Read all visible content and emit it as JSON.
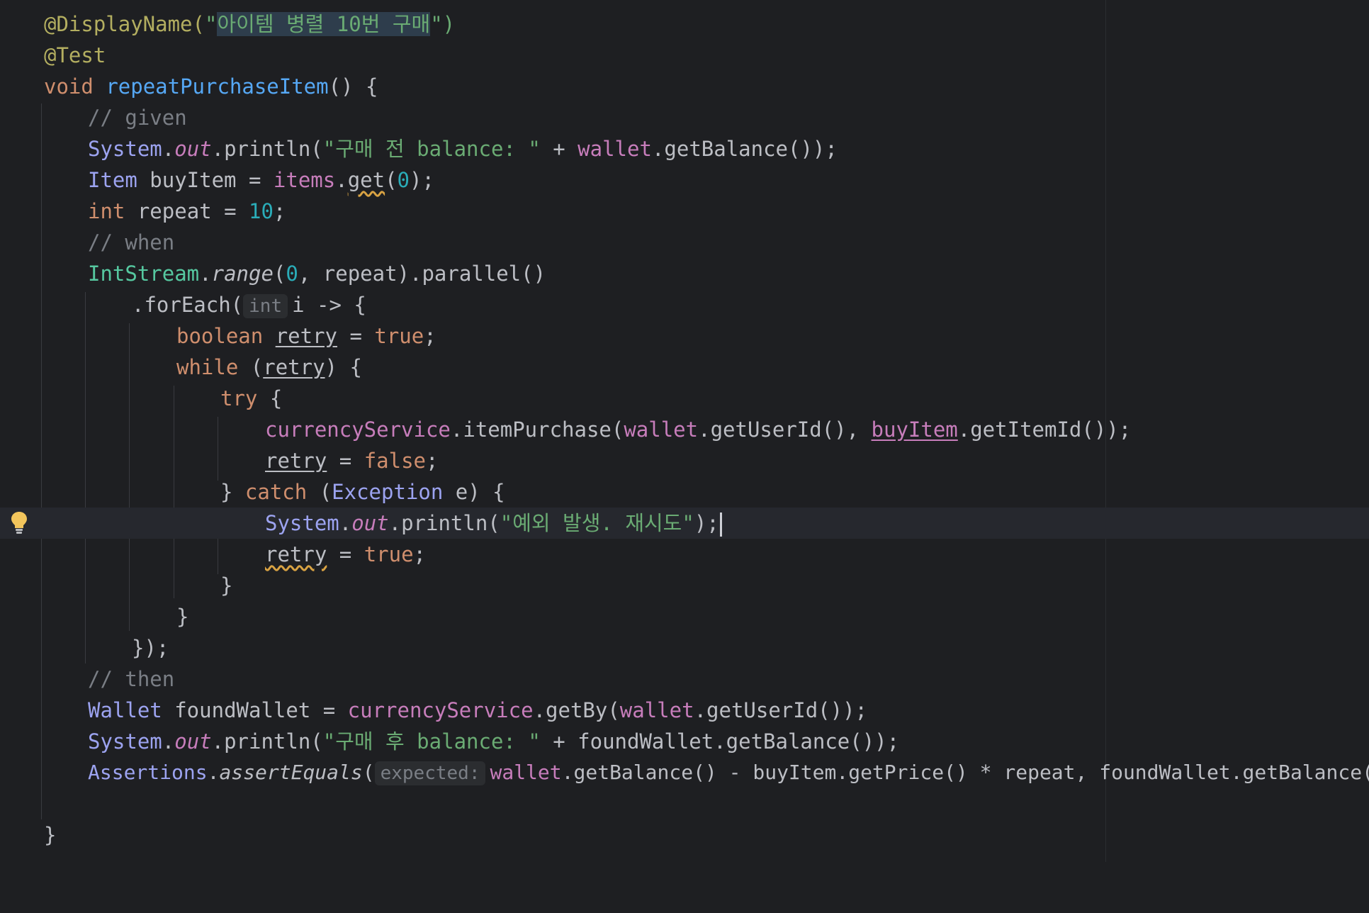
{
  "editor": {
    "display_name_annotation": "@DisplayName(",
    "display_name_quote_open": "\"",
    "display_name_value": "아이템 병렬 10번 구매",
    "display_name_close": "\")",
    "test_annotation": "@Test",
    "method_kw": "void",
    "method_name": "repeatPurchaseItem",
    "method_tail": "() {",
    "comment_given": "// given",
    "l5": {
      "cls": "System",
      "dot": ".",
      "out": "out",
      "mid": ".println(",
      "str": "\"구매 전 balance: \"",
      "plus": " + ",
      "field": "wallet",
      "tail": ".getBalance());"
    },
    "l6": {
      "cls": "Item",
      "var": " buyItem = ",
      "field": "items",
      "dot": ".",
      "get": "get",
      "open": "(",
      "num": "0",
      "close": ");"
    },
    "l7": {
      "kw": "int",
      "var": " repeat = ",
      "num": "10",
      "tail": ";"
    },
    "comment_when": "// when",
    "l9": {
      "cls": "IntStream",
      "dot": ".",
      "fn": "range",
      "open": "(",
      "num": "0",
      "tail": ", repeat).parallel()"
    },
    "l10": {
      "head": ".forEach(",
      "hint": "int",
      "tail": "i -> {"
    },
    "l11": {
      "kw": "boolean",
      "sp": " ",
      "var": "retry",
      "eq": " = ",
      "val": "true",
      "tail": ";"
    },
    "l12": {
      "kw": "while",
      "open": " (",
      "var": "retry",
      "tail": ") {"
    },
    "l13": {
      "kw": "try",
      "tail": " {"
    },
    "l14": {
      "field": "currencyService",
      "mid": ".itemPurchase(",
      "field2": "wallet",
      "mid2": ".getUserId(), ",
      "var": "buyItem",
      "tail": ".getItemId());"
    },
    "l15": {
      "var": "retry",
      "eq": " = ",
      "val": "false",
      "tail": ";"
    },
    "l16": {
      "head": "} ",
      "kw": "catch",
      "open": " (",
      "cls": "Exception",
      "tail": " e) {"
    },
    "l17": {
      "cls": "System",
      "dot": ".",
      "out": "out",
      "mid": ".println(",
      "str": "\"예외 발생. 재시도\"",
      "tail": ");"
    },
    "l18": {
      "var": "retry",
      "eq": " = ",
      "val": "true",
      "tail": ";"
    },
    "l19": "}",
    "l20": "}",
    "l21": "});",
    "comment_then": "// then",
    "l23": {
      "cls": "Wallet",
      "var": " foundWallet = ",
      "field": "currencyService",
      "mid": ".getBy(",
      "field2": "wallet",
      "tail": ".getUserId());"
    },
    "l24": {
      "cls": "System",
      "dot": ".",
      "out": "out",
      "mid": ".println(",
      "str": "\"구매 후 balance: \"",
      "tail": " + foundWallet.getBalance());"
    },
    "l25": {
      "cls": "Assertions",
      "dot": ".",
      "fn": "assertEquals",
      "open": "(",
      "hint": "expected:",
      "field": "wallet",
      "tail": ".getBalance() - buyItem.getPrice() * repeat, foundWallet.getBalance());"
    },
    "l27": "}"
  },
  "icons": {
    "gutter": "lightbulb-icon"
  },
  "colors": {
    "background": "#1e1f22",
    "keyword": "#cf8e6d",
    "string": "#6aab73",
    "annotation": "#b3ae60",
    "method": "#56a8f5",
    "field": "#c77dbb",
    "number": "#2aacb8",
    "comment": "#7a7e85"
  }
}
